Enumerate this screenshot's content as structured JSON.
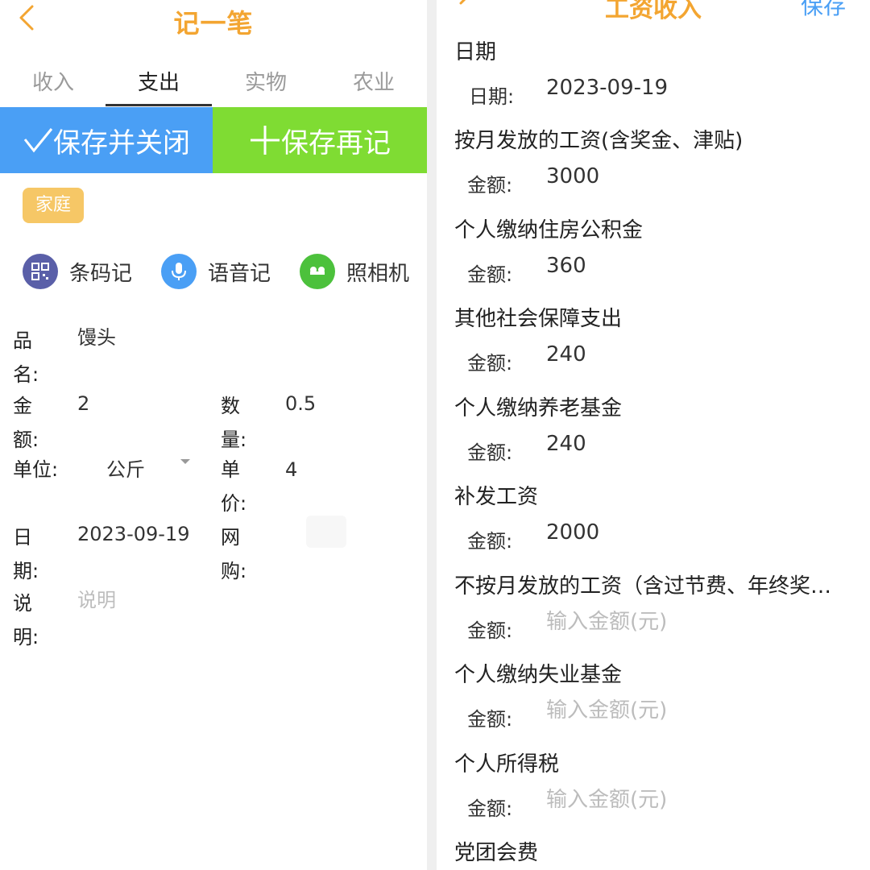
{
  "left": {
    "title": "记一笔",
    "tabs": [
      {
        "label": "收入"
      },
      {
        "label": "支出",
        "active": true
      },
      {
        "label": "实物"
      },
      {
        "label": "农业"
      }
    ],
    "buttons": {
      "save_close": "保存并关闭",
      "save_again": "保存再记"
    },
    "tag": "家庭",
    "tools": [
      {
        "label": "条码记",
        "icon": "qrcode-icon",
        "color": "#5a5fa8"
      },
      {
        "label": "语音记",
        "icon": "microphone-icon",
        "color": "#4a9ff5"
      },
      {
        "label": "照相机",
        "icon": "camera-icon",
        "color": "#4cc13c"
      }
    ],
    "form": {
      "name_label_1": "品",
      "name_label_2": "名:",
      "name_value": "馒头",
      "amount_label_1": "金",
      "amount_label_2": "额:",
      "amount_value": "2",
      "qty_label_1": "数",
      "qty_label_2": "量:",
      "qty_value": "0.5",
      "unit_label": "单位:",
      "unit_value": "公斤",
      "price_label_1": "单",
      "price_label_2": "价:",
      "price_value": "4",
      "date_label_1": "日",
      "date_label_2": "期:",
      "date_value": "2023-09-19",
      "online_label_1": "网",
      "online_label_2": "购:",
      "note_label_1": "说",
      "note_label_2": "明:",
      "note_placeholder": "说明"
    }
  },
  "right": {
    "title": "工资收入",
    "save": "保存",
    "date_section": "日期",
    "date_label": "日期:",
    "date_value": "2023-09-19",
    "amount_label": "金额:",
    "amount_placeholder": "输入金额(元)",
    "items": [
      {
        "title": "按月发放的工资(含奖金、津贴)",
        "value": "3000"
      },
      {
        "title": "个人缴纳住房公积金",
        "value": "360"
      },
      {
        "title": "其他社会保障支出",
        "value": "240"
      },
      {
        "title": "个人缴纳养老基金",
        "value": "240"
      },
      {
        "title": "补发工资",
        "value": "2000"
      },
      {
        "title": "不按月发放的工资（含过节费、年终奖…",
        "value": ""
      },
      {
        "title": "个人缴纳失业基金",
        "value": ""
      },
      {
        "title": "个人所得税",
        "value": ""
      },
      {
        "title": "党团会费",
        "value": ""
      }
    ]
  },
  "colors": {
    "accent_orange": "#f3a531",
    "blue": "#4a9ff5",
    "green": "#7fdc33",
    "tag": "#f6c766"
  }
}
